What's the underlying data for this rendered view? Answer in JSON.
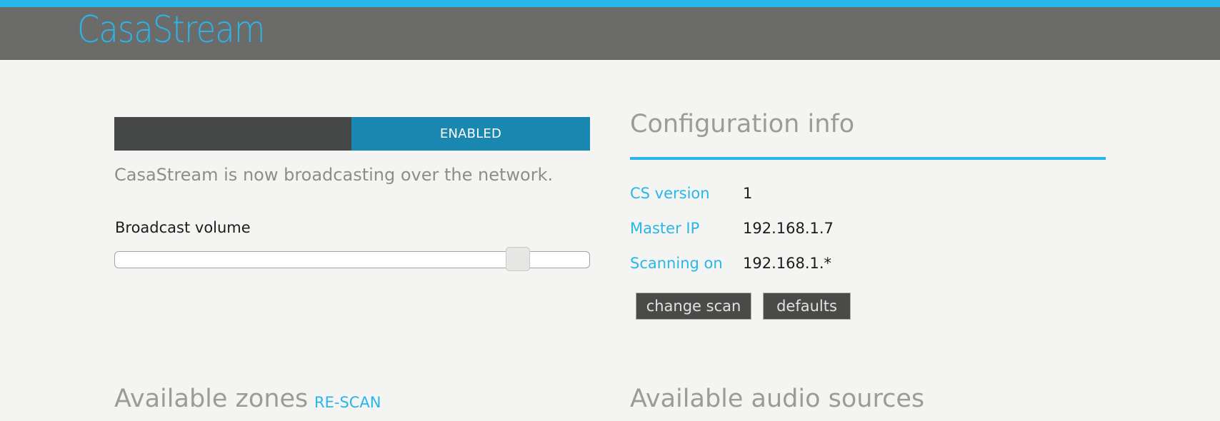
{
  "app": {
    "title": "CasaStream",
    "accent_color": "#29b6ea",
    "header_color": "#6b6b69"
  },
  "broadcast": {
    "toggle_state": "ENABLED",
    "toggle_on_color": "#1a87b0",
    "status_message": "CasaStream is now broadcasting over the network.",
    "volume_label": "Broadcast volume",
    "volume_level_percent": 87
  },
  "config": {
    "title": "Configuration info",
    "rows": [
      {
        "key": "CS version",
        "value": "1"
      },
      {
        "key": "Master IP",
        "value": "192.168.1.7"
      },
      {
        "key": "Scanning on",
        "value": "192.168.1.*"
      }
    ],
    "buttons": {
      "change_scan": "change scan",
      "defaults": "defaults"
    }
  },
  "zones": {
    "title": "Available zones",
    "rescan_label": "RE-SCAN"
  },
  "sources": {
    "title": "Available audio sources"
  }
}
